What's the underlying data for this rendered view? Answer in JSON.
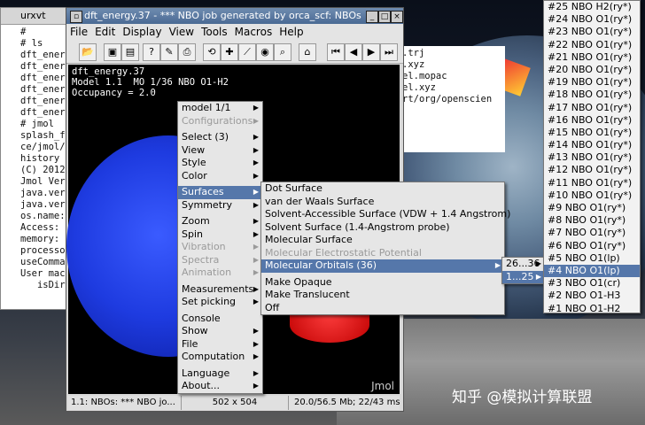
{
  "terminal": {
    "title": "urxvt",
    "lines": [
      "#",
      "# ls",
      "dft_ener",
      "dft_ener",
      "dft_ener",
      "dft_ener",
      "dft_ener",
      "dft_ener",
      "# jmol",
      "splash_f",
      "ce/jmol/",
      "history",
      "(C) 2012",
      "Jmol Ver",
      "java.ver",
      "java.ver",
      "os.name:",
      "Access:",
      "memory:",
      "processo",
      "useComma",
      "User mac",
      "",
      "   isDire"
    ]
  },
  "bg_terminal": {
    "lines": [
      ".trj",
      ".xyz",
      "el.mopac",
      "el.xyz",
      "",
      "",
      "",
      "",
      "rt/org/openscien"
    ]
  },
  "jmol": {
    "title": "dft_energy.37 - *** NBO job generated by orca_scf: NBOs",
    "menus": [
      "File",
      "Edit",
      "Display",
      "View",
      "Tools",
      "Macros",
      "Help"
    ],
    "canvas_text": [
      "dft_energy.37",
      "Model 1.1  MO 1/36 NBO O1-H2",
      "Occupancy = 2.0"
    ],
    "logo": "Jmol",
    "status": {
      "left": "1.1: NBOs: *** NBO jo...",
      "size": "502 x 504",
      "mem": "20.0/56.5 Mb;  22/43 ms"
    }
  },
  "popup": {
    "items": [
      {
        "label": "model 1/1",
        "disabled": false,
        "arrow": true
      },
      {
        "label": "Configurations",
        "disabled": true,
        "arrow": true
      },
      {
        "sep": true
      },
      {
        "label": "Select (3)",
        "disabled": false,
        "arrow": true
      },
      {
        "label": "View",
        "disabled": false,
        "arrow": true
      },
      {
        "label": "Style",
        "disabled": false,
        "arrow": true
      },
      {
        "label": "Color",
        "disabled": false,
        "arrow": true
      },
      {
        "sep": true
      },
      {
        "label": "Surfaces",
        "disabled": false,
        "arrow": true,
        "selected": true
      },
      {
        "label": "Symmetry",
        "disabled": false,
        "arrow": true
      },
      {
        "sep": true
      },
      {
        "label": "Zoom",
        "disabled": false,
        "arrow": true
      },
      {
        "label": "Spin",
        "disabled": false,
        "arrow": true
      },
      {
        "label": "Vibration",
        "disabled": true,
        "arrow": true
      },
      {
        "label": "Spectra",
        "disabled": true,
        "arrow": true
      },
      {
        "label": "Animation",
        "disabled": true,
        "arrow": true
      },
      {
        "sep": true
      },
      {
        "label": "Measurements",
        "disabled": false,
        "arrow": true
      },
      {
        "label": "Set picking",
        "disabled": false,
        "arrow": true
      },
      {
        "sep": true
      },
      {
        "label": "Console",
        "disabled": false,
        "arrow": false
      },
      {
        "label": "Show",
        "disabled": false,
        "arrow": true
      },
      {
        "label": "File",
        "disabled": false,
        "arrow": true
      },
      {
        "label": "Computation",
        "disabled": false,
        "arrow": true
      },
      {
        "sep": true
      },
      {
        "label": "Language",
        "disabled": false,
        "arrow": true
      },
      {
        "label": "About...",
        "disabled": false,
        "arrow": true
      }
    ]
  },
  "surfaces": {
    "items": [
      {
        "label": "Dot Surface",
        "disabled": false
      },
      {
        "label": "van der Waals Surface",
        "disabled": false
      },
      {
        "label": "Solvent-Accessible Surface (VDW + 1.4 Angstrom)",
        "disabled": false
      },
      {
        "label": "Solvent Surface (1.4-Angstrom probe)",
        "disabled": false
      },
      {
        "label": "Molecular Surface",
        "disabled": false
      },
      {
        "label": "Molecular Electrostatic Potential",
        "disabled": true
      },
      {
        "label": "Molecular Orbitals (36)",
        "disabled": false,
        "selected": true,
        "arrow": true
      },
      {
        "sep": true
      },
      {
        "label": "Make Opaque",
        "disabled": false
      },
      {
        "label": "Make Translucent",
        "disabled": false
      },
      {
        "label": "Off",
        "disabled": false
      }
    ]
  },
  "mo_ranges": {
    "items": [
      {
        "label": "26...36",
        "selected": false
      },
      {
        "label": "1...25",
        "selected": true
      }
    ]
  },
  "nbo_list": {
    "items": [
      "#25 NBO H2(ry*)",
      "#24 NBO O1(ry*)",
      "#23 NBO O1(ry*)",
      "#22 NBO O1(ry*)",
      "#21 NBO O1(ry*)",
      "#20 NBO O1(ry*)",
      "#19 NBO O1(ry*)",
      "#18 NBO O1(ry*)",
      "#17 NBO O1(ry*)",
      "#16 NBO O1(ry*)",
      "#15 NBO O1(ry*)",
      "#14 NBO O1(ry*)",
      "#13 NBO O1(ry*)",
      "#12 NBO O1(ry*)",
      "#11 NBO O1(ry*)",
      "#10 NBO O1(ry*)",
      "#9 NBO O1(ry*)",
      "#8 NBO O1(ry*)",
      "#7 NBO O1(ry*)",
      "#6 NBO O1(ry*)",
      "#5 NBO O1(lp)",
      "#4 NBO O1(lp)",
      "#3 NBO O1(cr)",
      "#2 NBO O1-H3",
      "#1 NBO O1-H2"
    ],
    "selected_index": 21
  },
  "watermark": "知乎 @模拟计算联盟"
}
